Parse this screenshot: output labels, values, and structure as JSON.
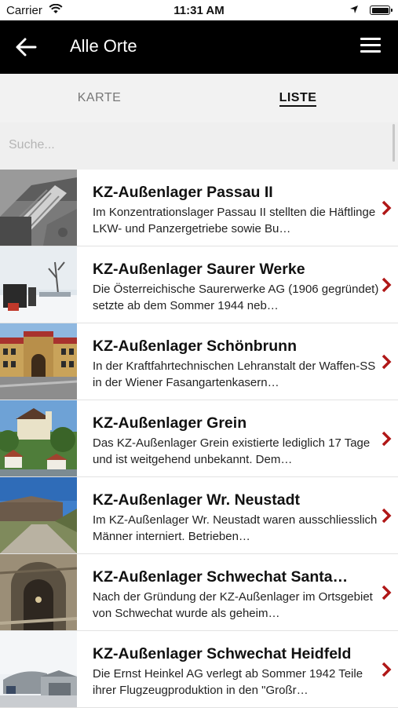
{
  "status_bar": {
    "carrier": "Carrier",
    "time": "11:31 AM"
  },
  "app_bar": {
    "title": "Alle Orte"
  },
  "tabs": [
    {
      "label": "KARTE",
      "active": false
    },
    {
      "label": "LISTE",
      "active": true
    }
  ],
  "search": {
    "placeholder": "Suche...",
    "value": ""
  },
  "accent_color": "#b01717",
  "items": [
    {
      "title": "KZ-Außenlager Passau II",
      "description": "Im Konzentrationslager Passau II stellten die Häftlinge LKW- und Panzergetriebe sowie Bu…",
      "image": "aerial-photo"
    },
    {
      "title": "KZ-Außenlager Saurer Werke",
      "description": "Die Österreichische Saurerwerke AG (1906 gegründet) setzte ab dem Sommer 1944 neb…",
      "image": "memorial-photo"
    },
    {
      "title": "KZ-Außenlager Schönbrunn",
      "description": "In der Kraftfahrtechnischen Lehranstalt der Waffen-SS in der Wiener Fasangartenkasern…",
      "image": "building-photo"
    },
    {
      "title": "KZ-Außenlager Grein",
      "description": "Das KZ-Außenlager Grein existierte lediglich 17 Tage und ist weitgehend unbekannt. Dem…",
      "image": "town-photo"
    },
    {
      "title": "KZ-Außenlager Wr. Neustadt",
      "description": "Im KZ-Außenlager Wr. Neustadt waren ausschliesslich Männer interniert. Betrieben…",
      "image": "factory-photo"
    },
    {
      "title": "KZ-Außenlager Schwechat Santa…",
      "description": "Nach der Gründung der KZ-Außenlager im Ortsgebiet von Schwechat wurde als geheim…",
      "image": "tunnel-photo"
    },
    {
      "title": "KZ-Außenlager Schwechat Heidfeld",
      "description": "Die Ernst Heinkel AG verlegt ab Sommer 1942 Teile ihrer Flugzeugproduktion in den \"Großr…",
      "image": "hangar-photo"
    }
  ]
}
